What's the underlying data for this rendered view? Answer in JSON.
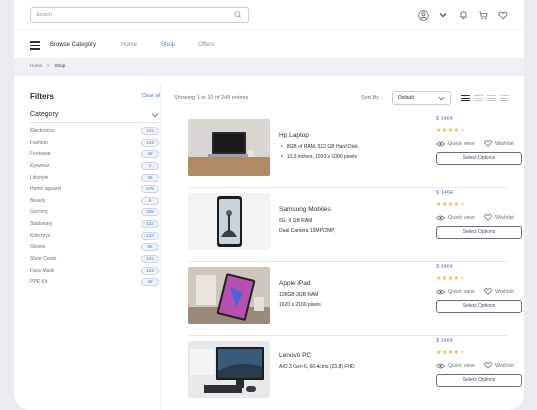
{
  "search": {
    "placeholder": "Search"
  },
  "nav": {
    "browse_label": "Browse Category",
    "items": [
      {
        "label": "Home"
      },
      {
        "label": "Shop"
      },
      {
        "label": "Offers"
      }
    ]
  },
  "breadcrumb": {
    "home": "Home",
    "separator": ">",
    "current": "Shop"
  },
  "sidebar": {
    "title": "Filters",
    "clear_label": "Clear all",
    "category_title": "Category",
    "categories": [
      {
        "label": "Electronics",
        "count": "103"
      },
      {
        "label": "Fashion",
        "count": "123"
      },
      {
        "label": "Footwear",
        "count": "43"
      },
      {
        "label": "Eyewear",
        "count": "1"
      },
      {
        "label": "Lifestyle",
        "count": "45"
      },
      {
        "label": "Home apparel",
        "count": "678"
      },
      {
        "label": "Beauty",
        "count": "5"
      },
      {
        "label": "Grocery",
        "count": "455"
      },
      {
        "label": "Stationary",
        "count": "123"
      },
      {
        "label": "Kids toys",
        "count": "133"
      },
      {
        "label": "Gloves",
        "count": "65"
      },
      {
        "label": "Shoe Cover",
        "count": "133"
      },
      {
        "label": "Face Mask",
        "count": "123"
      },
      {
        "label": "PPE Kit",
        "count": "43"
      }
    ]
  },
  "listing": {
    "showing_text": "Showing 1 to 10 of 249 entries",
    "sort_label": "Sort By :",
    "sort_value": "Default"
  },
  "actions": {
    "quick_view": "Quick view",
    "wishlist": "Wishlist",
    "select_options": "Select Options"
  },
  "products": [
    {
      "name": "Hp Laptop",
      "specs": [
        "8GB of RAM, 512 GB Hard Disk",
        "13.3 inches, 1920 x 1080 pixels"
      ],
      "price": "$ 1464",
      "rating": 4
    },
    {
      "name": "Samsung Mobiles",
      "specs": [
        "5G, 6 GB RAM",
        "Dual Camera 13MP/2MP,"
      ],
      "price": "$ 1464",
      "rating": 4
    },
    {
      "name": "Apple iPad",
      "specs": [
        "128GB 3GB RAM",
        "1620 x 2160 pixels"
      ],
      "price": "$ 1464",
      "rating": 4
    },
    {
      "name": "Lenovo PC",
      "specs": [
        "AIO 3 Gen 6, 60.4cms (23.8) FHD"
      ],
      "price": "$ 1464",
      "rating": 4
    }
  ],
  "colors": {
    "accent": "#4b7bd8",
    "star": "#f2b233",
    "badge_bg": "#eef3fc"
  },
  "icons": [
    "search-icon",
    "user-avatar-icon",
    "chevron-down-icon",
    "bell-icon",
    "cart-icon",
    "heart-icon",
    "eye-icon"
  ]
}
